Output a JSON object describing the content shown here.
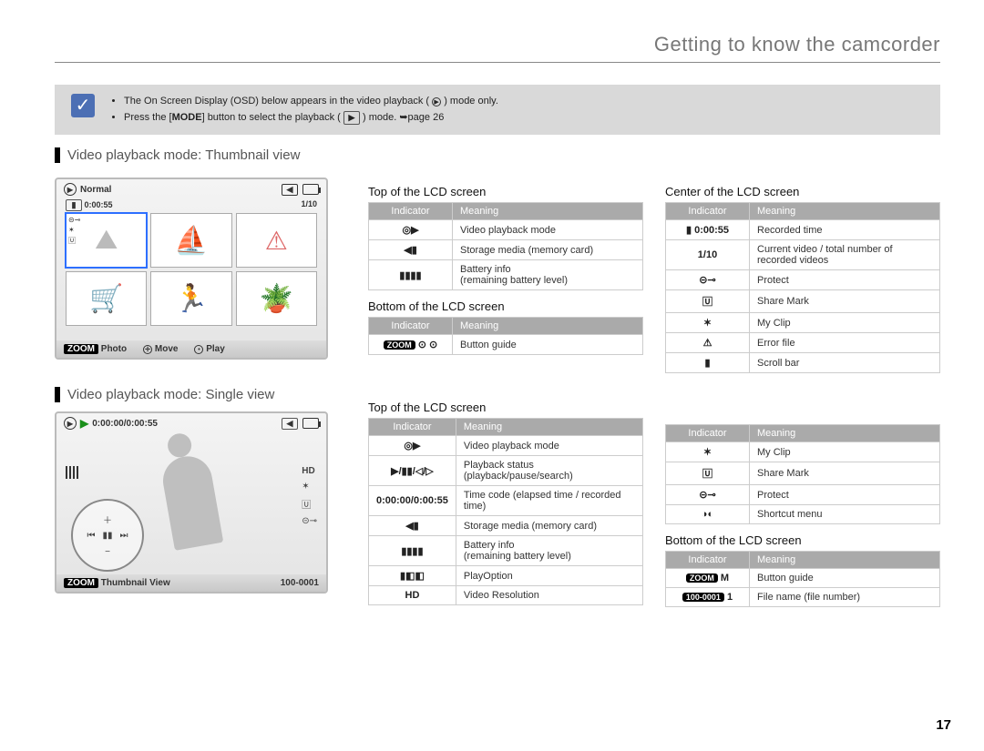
{
  "header": {
    "title": "Getting to know the camcorder"
  },
  "pageNumber": "17",
  "notes": {
    "b1": "The On Screen Display (OSD) below appears in the video playback (",
    "b1b": ") mode only.",
    "b2a": "Press the [",
    "b2mode": "MODE",
    "b2b": "] button to select the playback (",
    "b2c": ") mode. ",
    "b2page": "page 26"
  },
  "sections": {
    "thumb": "Video playback mode: Thumbnail view",
    "single": "Video playback mode: Single view"
  },
  "lcdThumb": {
    "normal": "Normal",
    "time": "0:00:55",
    "count": "1/10",
    "footZoom": "ZOOM",
    "footPhoto": "Photo",
    "footMove": "Move",
    "footPlay": "Play"
  },
  "lcdSingle": {
    "time": "0:00:00/0:00:55",
    "footZoom": "ZOOM",
    "footThumb": "Thumbnail View",
    "footFile": "100-0001",
    "hd": "HD"
  },
  "colHeads": {
    "indicator": "Indicator",
    "meaning": "Meaning"
  },
  "sub": {
    "top": "Top of the LCD screen",
    "bottom": "Bottom of the LCD screen",
    "center": "Center of the LCD screen"
  },
  "thumbTop": [
    {
      "i": "◎▶",
      "m": "Video playback mode"
    },
    {
      "i": "◀▮",
      "m": "Storage media (memory card)"
    },
    {
      "i": "▮▮▮▮",
      "m": "Battery info\n(remaining battery level)"
    }
  ],
  "thumbBottom": [
    {
      "i": "ZOOM ⊙ ⊙",
      "m": "Button guide"
    }
  ],
  "thumbCenter": [
    {
      "i": "▮ 0:00:55",
      "m": "Recorded time"
    },
    {
      "i": "1/10",
      "m": "Current video / total number of recorded videos"
    },
    {
      "i": "⊝⊸",
      "m": "Protect"
    },
    {
      "i": "🅄",
      "m": "Share Mark"
    },
    {
      "i": "✶",
      "m": "My Clip"
    },
    {
      "i": "⚠",
      "m": "Error file"
    },
    {
      "i": "▮",
      "m": "Scroll bar"
    }
  ],
  "singleTopL": [
    {
      "i": "◎▶",
      "m": "Video playback mode"
    },
    {
      "i": "▶/▮▮/◁/▷",
      "m": "Playback status (playback/pause/search)"
    },
    {
      "i": "0:00:00/0:00:55",
      "m": "Time code (elapsed time / recorded time)"
    },
    {
      "i": "◀▮",
      "m": "Storage media (memory card)"
    },
    {
      "i": "▮▮▮▮",
      "m": "Battery info\n(remaining battery level)"
    },
    {
      "i": "▮◧◧",
      "m": "PlayOption"
    },
    {
      "i": "HD",
      "m": "Video Resolution"
    }
  ],
  "singleTopR": [
    {
      "i": "✶",
      "m": "My Clip"
    },
    {
      "i": "🅄",
      "m": "Share Mark"
    },
    {
      "i": "⊝⊸",
      "m": "Protect"
    },
    {
      "i": "◑◐",
      "m": "Shortcut menu"
    }
  ],
  "singleBottom": [
    {
      "i": "ZOOM",
      "m": "Button guide"
    },
    {
      "i": "100-0001",
      "m": "File name (file number)"
    }
  ]
}
